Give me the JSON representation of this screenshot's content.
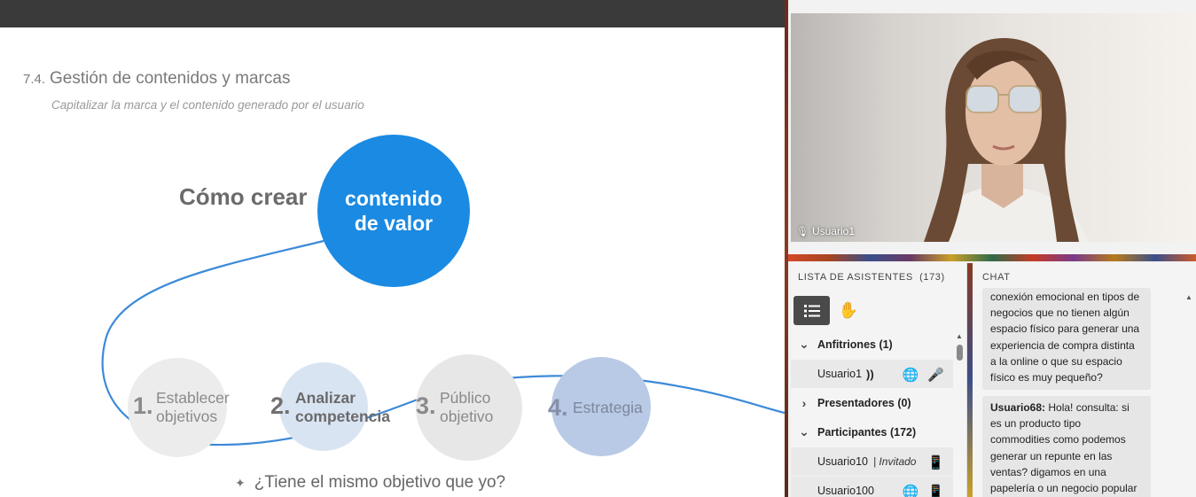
{
  "slide": {
    "section_number": "7.4.",
    "heading": "Gestión de contenidos y marcas",
    "subtitle": "Capitalizar la marca y el contenido generado por el usuario",
    "lead_text": "Cómo crear",
    "circle_line1": "contenido",
    "circle_line2": "de valor",
    "steps": [
      {
        "number": "1.",
        "line1": "Establecer",
        "line2": "objetivos"
      },
      {
        "number": "2.",
        "line1": "Analizar",
        "line2": "competencia"
      },
      {
        "number": "3.",
        "line1": "Público",
        "line2": "objetivo"
      },
      {
        "number": "4.",
        "line1": "Estrategia",
        "line2": ""
      }
    ],
    "question": "¿Tiene el mismo objetivo que yo?",
    "colors": {
      "accent_blue": "#1a8ae3",
      "curve": "#3d8ad8"
    }
  },
  "video": {
    "speaker_name": "Usuario1",
    "mic_icon": "mic-icon"
  },
  "attendees": {
    "title": "LISTA DE ASISTENTES",
    "count": "(173)",
    "groups": {
      "hosts": "Anfitriones (1)",
      "presenters": "Presentadores (0)",
      "participants": "Participantes (172)"
    },
    "people": [
      {
        "name": "Usuario1",
        "status": ""
      },
      {
        "name": "Usuario10",
        "status": "| Invitado"
      },
      {
        "name": "Usuario100",
        "status": ""
      }
    ]
  },
  "chat": {
    "title": "CHAT",
    "messages": [
      {
        "author": "",
        "text": "conexión emocional en tipos de negocios que no tienen algún espacio físico para generar una experiencia de compra distinta a la online o que su espacio físico es muy pequeño?"
      },
      {
        "author": "Usuario68:",
        "text": " Hola! consulta: si es un producto tipo commodities como podemos generar un repunte en las ventas? digamos en una papelería o un negocio popular"
      }
    ]
  }
}
